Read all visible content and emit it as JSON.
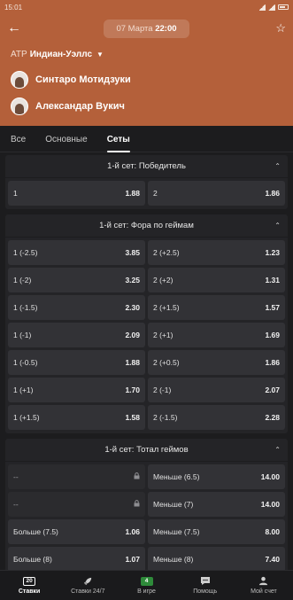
{
  "status": {
    "time": "15:01"
  },
  "topbar": {
    "date_prefix": "07 Марта",
    "date_time": "22:00"
  },
  "tournament": {
    "prefix": "ATP",
    "name": "Индиан-Уэллс"
  },
  "players": [
    {
      "name": "Синтаро Мотидзуки"
    },
    {
      "name": "Александар Вукич"
    }
  ],
  "tabs": [
    {
      "label": "Все",
      "active": false
    },
    {
      "label": "Основные",
      "active": false
    },
    {
      "label": "Сеты",
      "active": true
    }
  ],
  "sections": [
    {
      "title": "1-й сет: Победитель",
      "rows": [
        [
          {
            "label": "1",
            "odd": "1.88"
          },
          {
            "label": "2",
            "odd": "1.86"
          }
        ]
      ]
    },
    {
      "title": "1-й сет: Фора по геймам",
      "rows": [
        [
          {
            "label": "1 (-2.5)",
            "odd": "3.85"
          },
          {
            "label": "2 (+2.5)",
            "odd": "1.23"
          }
        ],
        [
          {
            "label": "1 (-2)",
            "odd": "3.25"
          },
          {
            "label": "2 (+2)",
            "odd": "1.31"
          }
        ],
        [
          {
            "label": "1 (-1.5)",
            "odd": "2.30"
          },
          {
            "label": "2 (+1.5)",
            "odd": "1.57"
          }
        ],
        [
          {
            "label": "1 (-1)",
            "odd": "2.09"
          },
          {
            "label": "2 (+1)",
            "odd": "1.69"
          }
        ],
        [
          {
            "label": "1 (-0.5)",
            "odd": "1.88"
          },
          {
            "label": "2 (+0.5)",
            "odd": "1.86"
          }
        ],
        [
          {
            "label": "1 (+1)",
            "odd": "1.70"
          },
          {
            "label": "2 (-1)",
            "odd": "2.07"
          }
        ],
        [
          {
            "label": "1 (+1.5)",
            "odd": "1.58"
          },
          {
            "label": "2 (-1.5)",
            "odd": "2.28"
          }
        ]
      ]
    },
    {
      "title": "1-й сет: Тотал геймов",
      "rows": [
        [
          {
            "label": "--",
            "odd": "",
            "locked": true
          },
          {
            "label": "Меньше (6.5)",
            "odd": "14.00"
          }
        ],
        [
          {
            "label": "--",
            "odd": "",
            "locked": true
          },
          {
            "label": "Меньше (7)",
            "odd": "14.00"
          }
        ],
        [
          {
            "label": "Больше (7.5)",
            "odd": "1.06"
          },
          {
            "label": "Меньше (7.5)",
            "odd": "8.00"
          }
        ],
        [
          {
            "label": "Больше (8)",
            "odd": "1.07"
          },
          {
            "label": "Меньше (8)",
            "odd": "7.40"
          }
        ]
      ]
    }
  ],
  "bottomnav": [
    {
      "label": "Ставки",
      "badge": "20",
      "icon": "bets-icon",
      "active": true
    },
    {
      "label": "Ставки 24/7",
      "icon": "rocket-icon",
      "active": false
    },
    {
      "label": "В игре",
      "badge": "4",
      "icon": "live-icon",
      "active": false
    },
    {
      "label": "Помощь",
      "icon": "chat-icon",
      "active": false
    },
    {
      "label": "Мой счет",
      "icon": "user-icon",
      "active": false
    }
  ],
  "colors": {
    "header": "#b4603a",
    "background": "#1c1c1e",
    "cell": "#323236",
    "live_badge": "#2e8b3a"
  }
}
